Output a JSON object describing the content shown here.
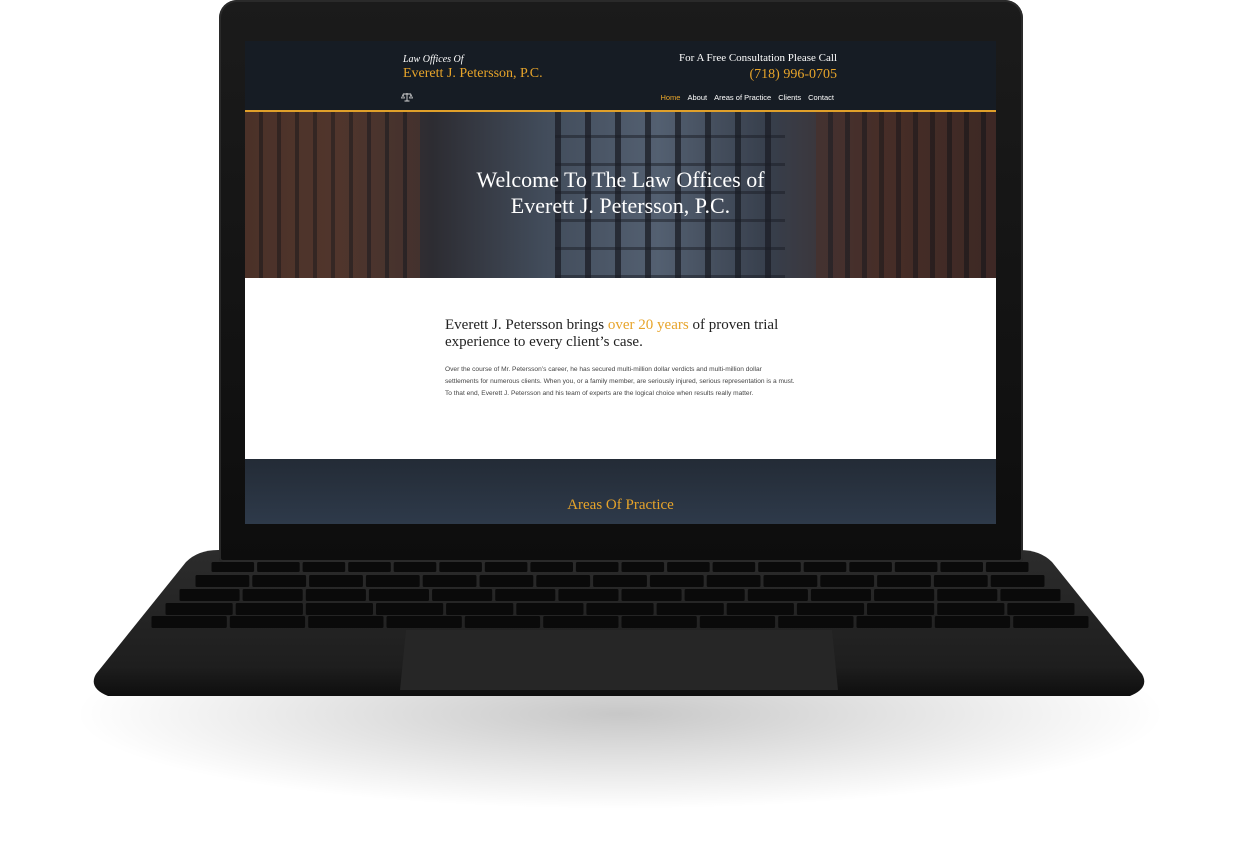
{
  "header": {
    "logo_small": "Law Offices Of",
    "logo_main": "Everett J. Petersson, P.C.",
    "consult_text": "For A Free Consultation Please Call",
    "phone": "(718) 996-0705"
  },
  "nav": {
    "items": [
      "Home",
      "About",
      "Areas of Practice",
      "Clients",
      "Contact"
    ],
    "active": "Home"
  },
  "hero": {
    "title_line1": "Welcome To The Law Offices of",
    "title_line2": "Everett J. Petersson, P.C."
  },
  "intro": {
    "lead_before": "Everett J. Petersson brings ",
    "lead_accent": "over 20 years",
    "lead_after": " of proven trial experience to every client’s case.",
    "body": "Over the course of Mr. Petersson’s career, he has secured multi-million dollar verdicts and multi-million dollar settlements for numerous clients. When you, or a family member, are seriously injured, serious representation is a must. To that end, Everett J. Petersson and his team of experts are the logical choice when results really matter."
  },
  "practice": {
    "title": "Areas Of Practice"
  },
  "colors": {
    "accent": "#e7a42a",
    "header_bg": "#161c24",
    "practice_bg": "#2a3442"
  },
  "icons": {
    "logo_mark": "scales-icon"
  }
}
